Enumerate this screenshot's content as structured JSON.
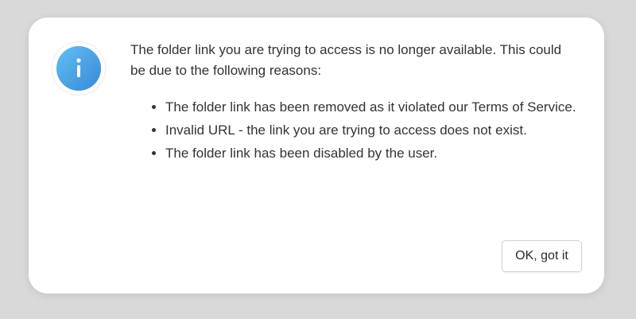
{
  "dialog": {
    "icon": "info-icon",
    "accent_color": "#4aa3e6",
    "message": "The folder link you are trying to access is no longer available. This could be due to the following reasons:",
    "reasons": [
      "The folder link has been removed as it violated our Terms of Service.",
      "Invalid URL - the link you are trying to access does not exist.",
      "The folder link has been disabled by the user."
    ],
    "confirm_label": "OK, got it"
  }
}
